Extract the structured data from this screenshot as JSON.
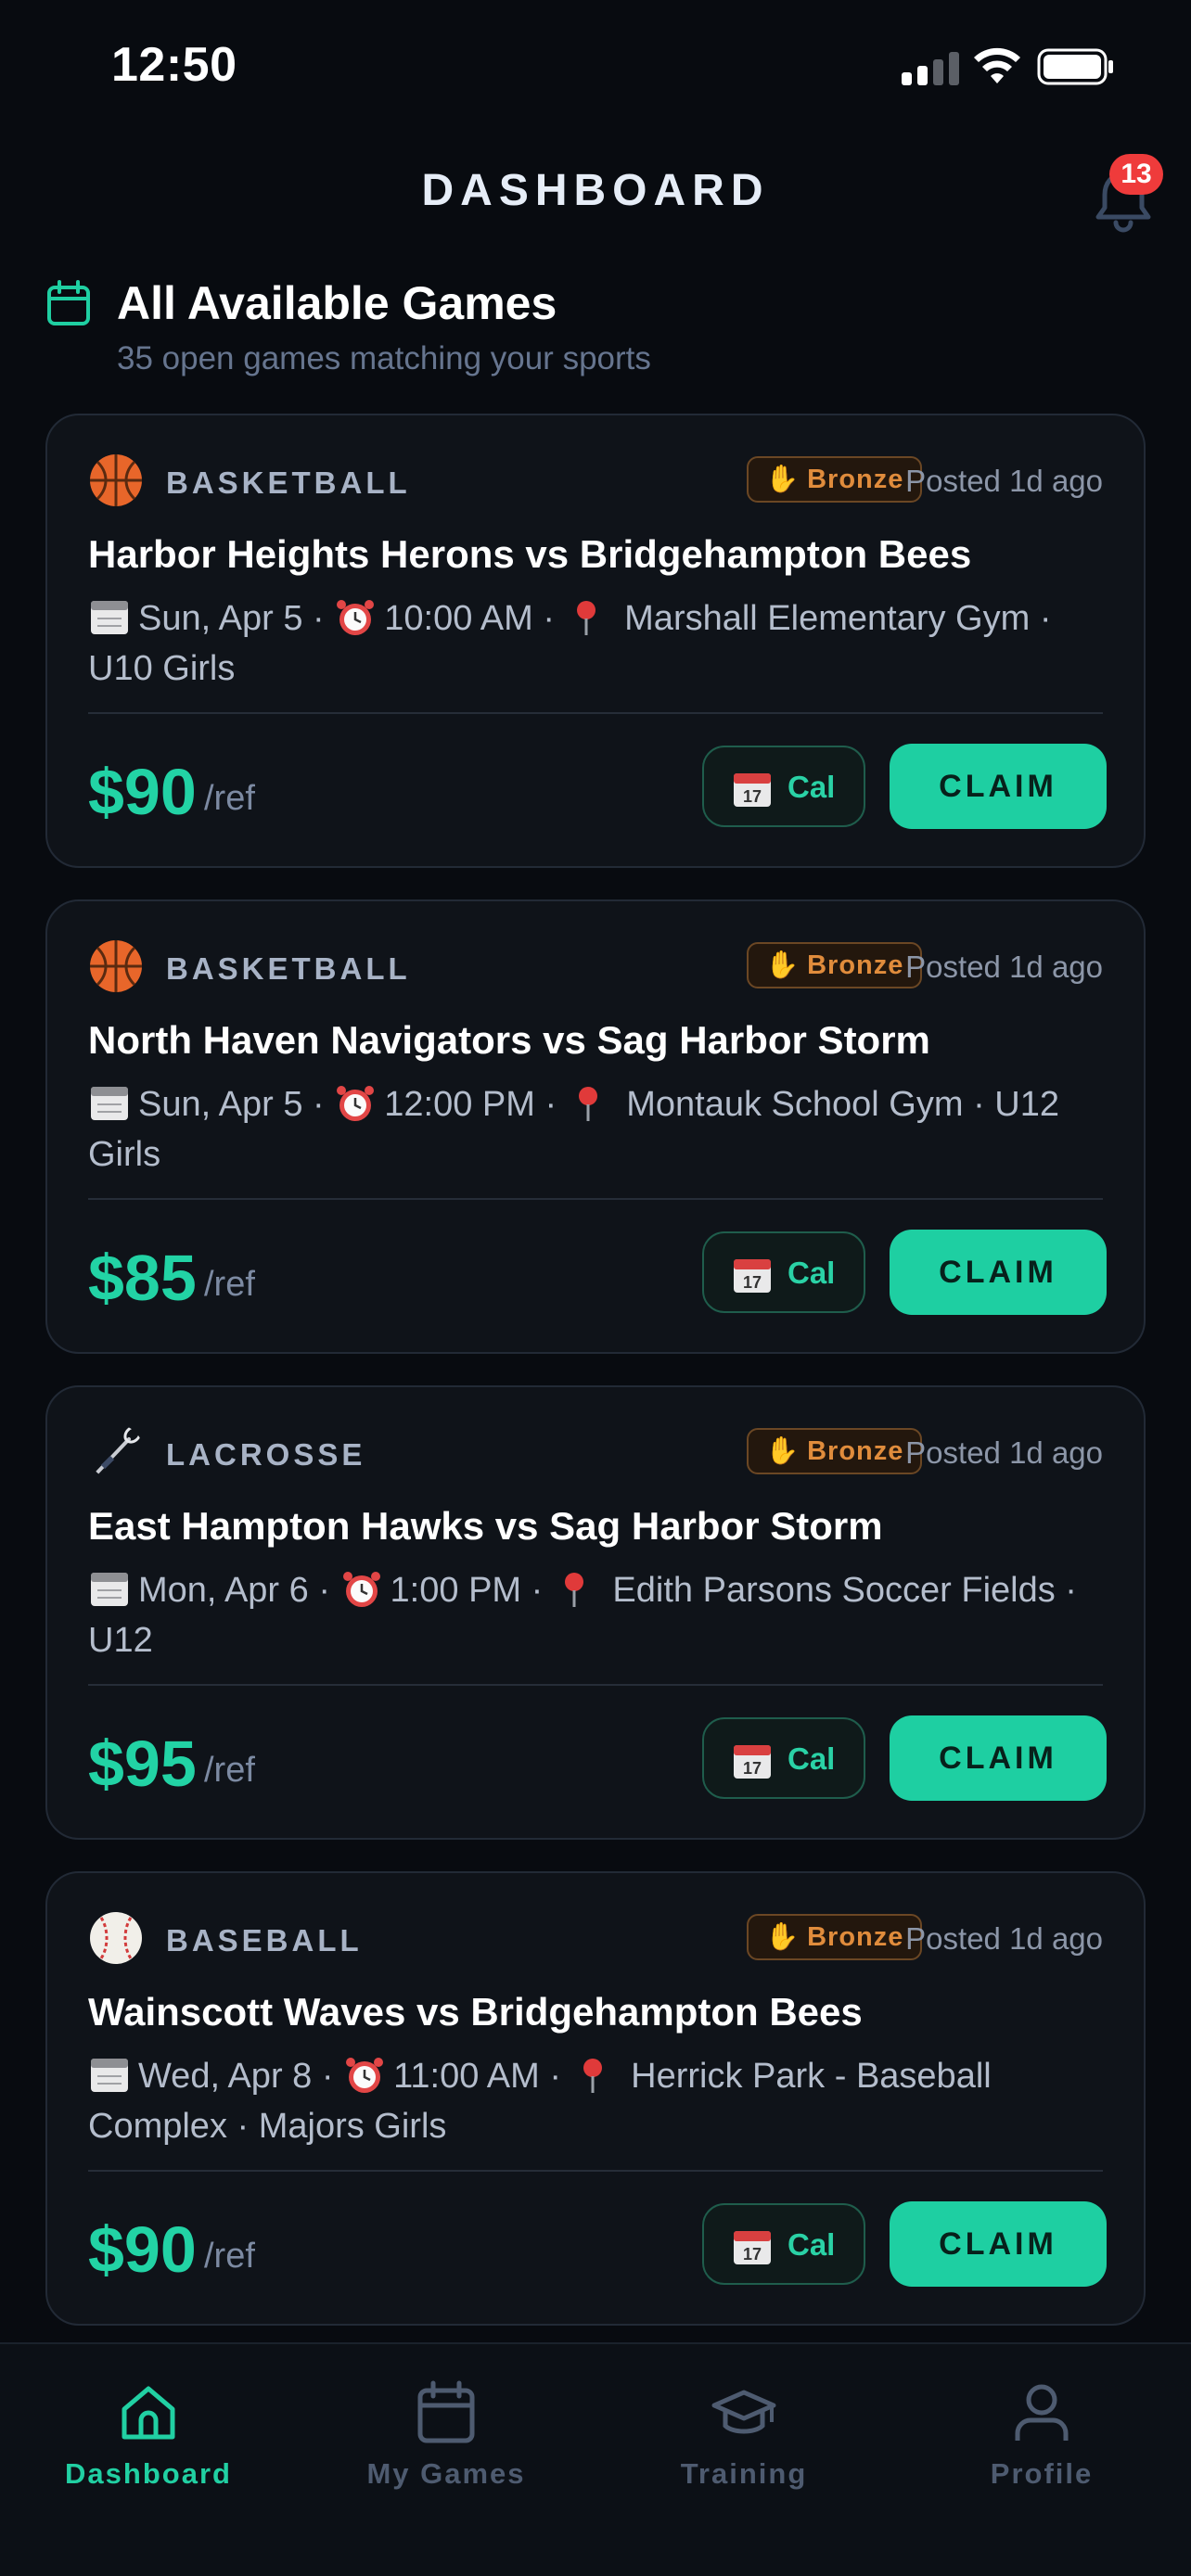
{
  "status_bar": {
    "time": "12:50"
  },
  "header": {
    "title": "DASHBOARD",
    "notification_count": "13"
  },
  "section": {
    "title": "All Available Games",
    "subtitle": "35 open games matching your sports"
  },
  "games": [
    {
      "sport": "BASKETBALL",
      "sport_icon": "basketball-icon",
      "tier": "Bronze",
      "posted": "Posted 1d ago",
      "matchup": "Harbor Heights Herons vs Bridgehampton Bees",
      "date": "Sun, Apr 5",
      "time": "10:00 AM",
      "location": "Marshall Elementary Gym",
      "division": "U10 Girls",
      "price": "$90",
      "per": "/ref",
      "cal_label": "Cal",
      "claim_label": "CLAIM"
    },
    {
      "sport": "BASKETBALL",
      "sport_icon": "basketball-icon",
      "tier": "Bronze",
      "posted": "Posted 1d ago",
      "matchup": "North Haven Navigators vs Sag Harbor Storm",
      "date": "Sun, Apr 5",
      "time": "12:00 PM",
      "location": "Montauk School Gym",
      "division": "U12 Girls",
      "price": "$85",
      "per": "/ref",
      "cal_label": "Cal",
      "claim_label": "CLAIM"
    },
    {
      "sport": "LACROSSE",
      "sport_icon": "lacrosse-icon",
      "tier": "Bronze",
      "posted": "Posted 1d ago",
      "matchup": "East Hampton Hawks vs Sag Harbor Storm",
      "date": "Mon, Apr 6",
      "time": "1:00 PM",
      "location": "Edith Parsons Soccer Fields",
      "division": "U12",
      "price": "$95",
      "per": "/ref",
      "cal_label": "Cal",
      "claim_label": "CLAIM"
    },
    {
      "sport": "BASEBALL",
      "sport_icon": "baseball-icon",
      "tier": "Bronze",
      "posted": "Posted 1d ago",
      "matchup": "Wainscott Waves vs Bridgehampton Bees",
      "date": "Wed, Apr 8",
      "time": "11:00 AM",
      "location": "Herrick Park - Baseball Complex",
      "division": "Majors Girls",
      "price": "$90",
      "per": "/ref",
      "cal_label": "Cal",
      "claim_label": "CLAIM"
    }
  ],
  "bottom_nav": [
    {
      "label": "Dashboard",
      "icon": "home-icon",
      "active": true
    },
    {
      "label": "My Games",
      "icon": "calendar-icon",
      "active": false
    },
    {
      "label": "Training",
      "icon": "graduation-cap-icon",
      "active": false
    },
    {
      "label": "Profile",
      "icon": "user-icon",
      "active": false
    }
  ],
  "colors": {
    "background": "#080b10",
    "card": "#0f1319",
    "accent": "#1ecfa2",
    "badge_bronze": "#e08c3c",
    "notification": "#ef3b3b"
  }
}
